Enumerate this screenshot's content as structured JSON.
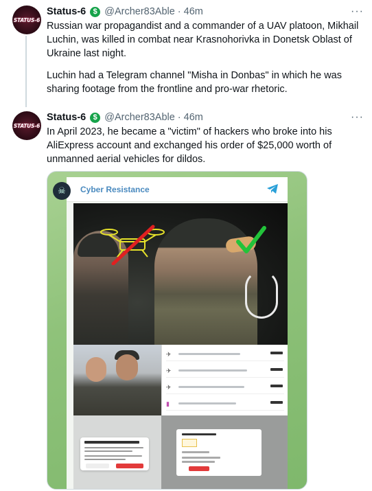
{
  "tweets": [
    {
      "avatar_text": "STATUS-6",
      "author_name": "Status-6",
      "badge_symbol": "$",
      "handle": "@Archer83Able",
      "separator": "·",
      "time": "46m",
      "more_label": "···",
      "paragraphs": [
        "Russian war propagandist and a commander of a UAV platoon, Mikhail Luchin, was killed in combat near Krasnohorivka in Donetsk Oblast of Ukraine last night.",
        "Luchin had a Telegram channel \"Misha in Donbas\" in which he was sharing footage from the frontline and pro-war rhetoric."
      ]
    },
    {
      "avatar_text": "STATUS-6",
      "author_name": "Status-6",
      "badge_symbol": "$",
      "handle": "@Archer83Able",
      "separator": "·",
      "time": "46m",
      "more_label": "···",
      "paragraphs": [
        "In April 2023, he became a \"victim\" of hackers who broke into his AliExpress account and exchanged his order of $25,000 worth of unmanned aerial vehicles for dildos."
      ],
      "media": {
        "channel_title": "Cyber Resistance",
        "channel_avatar_icon": "skull-icon",
        "share_icon": "telegram-plane-icon"
      }
    }
  ],
  "colors": {
    "badge_green": "#16a34a",
    "secondary_text": "#536471",
    "media_background": "#8fc27a",
    "telegram_blue": "#2aa0d8",
    "red_cross": "#e02020",
    "green_check": "#22c33a"
  }
}
